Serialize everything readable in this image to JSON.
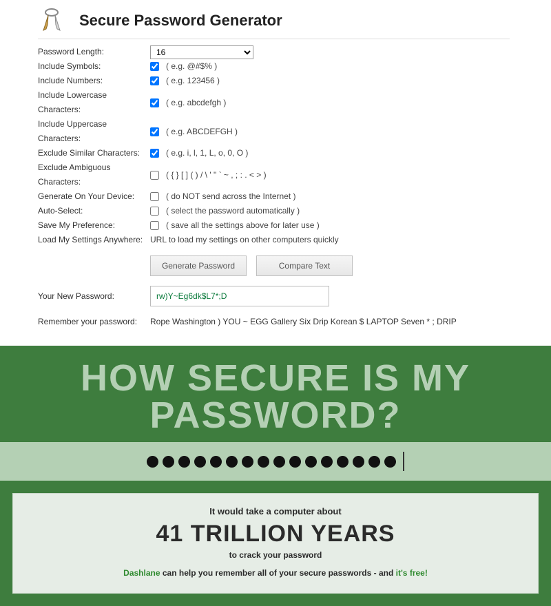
{
  "title": "Secure Password Generator",
  "options": {
    "length": {
      "label": "Password Length:",
      "value": "16"
    },
    "symbols": {
      "label": "Include Symbols:",
      "checked": true,
      "eg": "( e.g. @#$% )"
    },
    "numbers": {
      "label": "Include Numbers:",
      "checked": true,
      "eg": "( e.g. 123456 )"
    },
    "lower": {
      "label": "Include Lowercase Characters:",
      "checked": true,
      "eg": "( e.g. abcdefgh )"
    },
    "upper": {
      "label": "Include Uppercase Characters:",
      "checked": true,
      "eg": "( e.g. ABCDEFGH )"
    },
    "similar": {
      "label": "Exclude Similar Characters:",
      "checked": true,
      "eg": "( e.g. i, l, 1, L, o, 0, O )"
    },
    "ambiguous": {
      "label": "Exclude Ambiguous Characters:",
      "checked": false,
      "eg": "( { } [ ] ( ) / \\ ' \" ` ~ , ; : . < > )"
    },
    "device": {
      "label": "Generate On Your Device:",
      "checked": false,
      "eg": "( do NOT send across the Internet )"
    },
    "autoselect": {
      "label": "Auto-Select:",
      "checked": false,
      "eg": "( select the password automatically )"
    },
    "savepref": {
      "label": "Save My Preference:",
      "checked": false,
      "eg": "( save all the settings above for later use )"
    },
    "loadany": {
      "label": "Load My Settings Anywhere:",
      "text": "URL to load my settings on other computers quickly"
    }
  },
  "buttons": {
    "generate": "Generate Password",
    "compare": "Compare Text"
  },
  "result": {
    "label": "Your New Password:",
    "value": "rw)Y~Eg6dk$L7*;D",
    "rememberLabel": "Remember your password:",
    "rememberText": "Rope Washington ) YOU ~ EGG Gallery Six Drip Korean $ LAPTOP Seven * ; DRIP"
  },
  "banner": {
    "headline": "HOW SECURE IS MY PASSWORD?",
    "dots": 16,
    "line1": "It would take a computer about",
    "years": "41 TRILLION YEARS",
    "line3": "to crack your password",
    "dashlane_a": "Dashlane",
    "dashlane_mid": " can help you remember all of your secure passwords - and ",
    "dashlane_b": "it's free!"
  }
}
